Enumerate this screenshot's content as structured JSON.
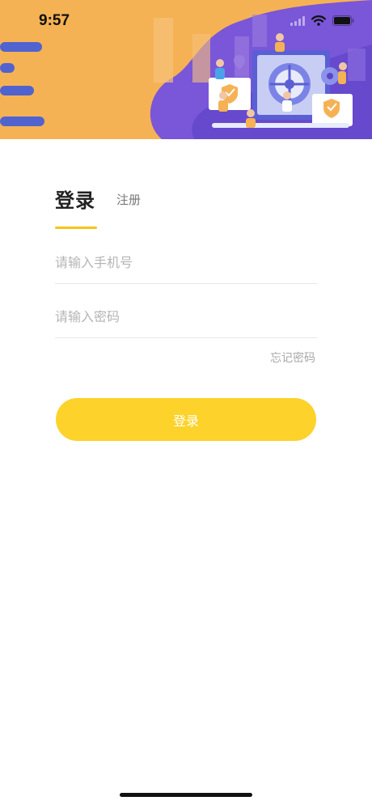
{
  "status": {
    "time": "9:57",
    "icons": [
      "signal-icon",
      "wifi-icon",
      "battery-icon"
    ]
  },
  "banner": {
    "illustration": "security-vault-illustration",
    "colors": {
      "background": "#f5b254",
      "purple": "#7a56d8",
      "blue": "#5a63d8"
    }
  },
  "tabs": {
    "login": "登录",
    "register": "注册"
  },
  "form": {
    "phone_placeholder": "请输入手机号",
    "password_placeholder": "请输入密码",
    "forgot_password": "忘记密码",
    "submit_label": "登录"
  },
  "colors": {
    "accent": "#fdd22a",
    "tab_underline": "#f5c518"
  }
}
